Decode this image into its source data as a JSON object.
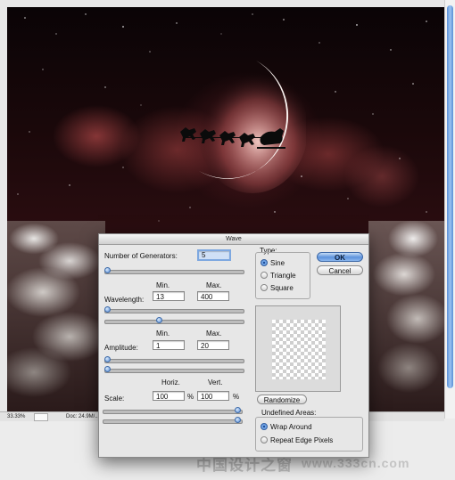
{
  "document": {
    "zoom": "33.33%",
    "doc_info": "Doc: 24.9M/..."
  },
  "dialog": {
    "title": "Wave",
    "generators": {
      "label": "Number of Generators:",
      "value": "5",
      "slider": 0.0
    },
    "min_header": "Min.",
    "max_header": "Max.",
    "wavelength": {
      "label": "Wavelength:",
      "min": "13",
      "max": "400",
      "slider_min": 0.0,
      "slider_max": 0.39
    },
    "amplitude": {
      "label": "Amplitude:",
      "min": "1",
      "max": "20",
      "slider_min": 0.0,
      "slider_max": 0.0
    },
    "scale": {
      "label": "Scale:",
      "horiz_header": "Horiz.",
      "vert_header": "Vert.",
      "horiz": "100",
      "vert": "100",
      "unit": "%",
      "slider_horiz": 1.0,
      "slider_vert": 1.0
    },
    "type": {
      "legend": "Type:",
      "options": [
        "Sine",
        "Triangle",
        "Square"
      ],
      "selected": "Sine"
    },
    "ok_label": "OK",
    "cancel_label": "Cancel",
    "randomize_label": "Randomize",
    "undefined_areas": {
      "legend": "Undefined Areas:",
      "options": [
        "Wrap Around",
        "Repeat Edge Pixels"
      ],
      "selected": "Wrap Around"
    }
  },
  "watermark": {
    "text": "中国设计之窗",
    "url": "www.333cn.com"
  },
  "colors": {
    "accent": "#5d92dc",
    "sky": "#2a0d10",
    "moon": "#fbf3f0"
  }
}
